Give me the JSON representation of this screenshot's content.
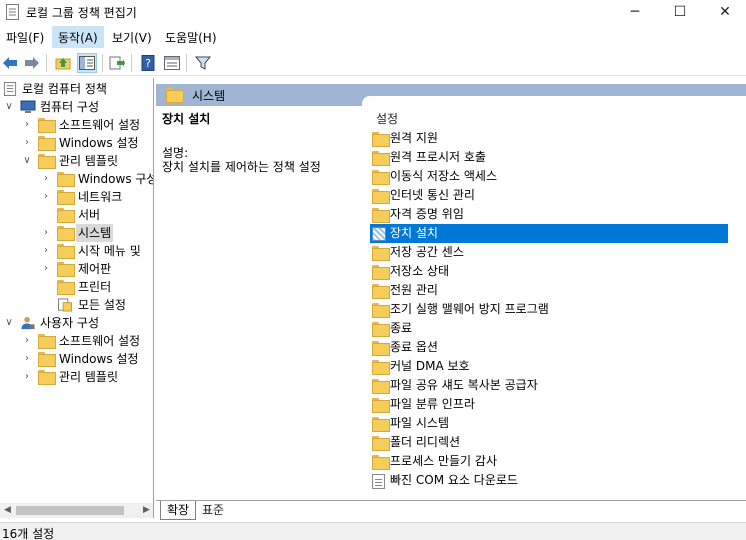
{
  "window": {
    "title": "로컬 그룹 정책 편집기",
    "minimize": "─",
    "maximize": "☐",
    "close": "✕"
  },
  "menu": {
    "items": [
      "파일(F)",
      "동작(A)",
      "보기(V)",
      "도움말(H)"
    ]
  },
  "toolbar": {
    "icons": [
      "back-arrow-icon",
      "forward-arrow-icon",
      "up-folder-icon",
      "show-hide-tree-icon",
      "export-list-icon",
      "help-icon",
      "properties-icon",
      "filter-icon"
    ]
  },
  "tree": {
    "root": "로컬 컴퓨터 정책",
    "computer_config": "컴퓨터 구성",
    "software_settings": "소프트웨어 설정",
    "windows_settings": "Windows 설정",
    "admin_templates": "관리 템플릿",
    "windows_components": "Windows 구성",
    "network": "네트워크",
    "server": "서버",
    "system": "시스템",
    "start_menu": "시작 메뉴 및",
    "control_panel": "제어판",
    "printers": "프린터",
    "all_settings": "모든 설정",
    "user_config": "사용자 구성",
    "user_software_settings": "소프트웨어 설정",
    "user_windows_settings": "Windows 설정",
    "user_admin_templates": "관리 템플릿"
  },
  "right": {
    "header": "시스템",
    "selected_title": "장치 설치",
    "desc_label": "설명:",
    "desc_text": "장치 설치를 제어하는 정책 설정",
    "list_header": "설정",
    "items": [
      "원격 지원",
      "원격 프로시저 호출",
      "이동식 저장소 액세스",
      "인터넷 통신 관리",
      "자격 증명 위임",
      "장치 설치",
      "저장 공간 센스",
      "저장소 상태",
      "전원 관리",
      "조기 실행 맬웨어 방지 프로그램",
      "종료",
      "종료 옵션",
      "커널 DMA 보호",
      "파일 공유 섀도 복사본 공급자",
      "파일 분류 인프라",
      "파일 시스템",
      "폴더 리디렉션",
      "프로세스 만들기 감사",
      "빠진 COM 요소 다운로드"
    ]
  },
  "tabs": [
    "확장",
    "표준"
  ],
  "status": {
    "text": "16개 설정"
  },
  "colors": {
    "selection": "#0078d7",
    "header": "#9fb5d2",
    "folder": "#f5cd5b"
  }
}
